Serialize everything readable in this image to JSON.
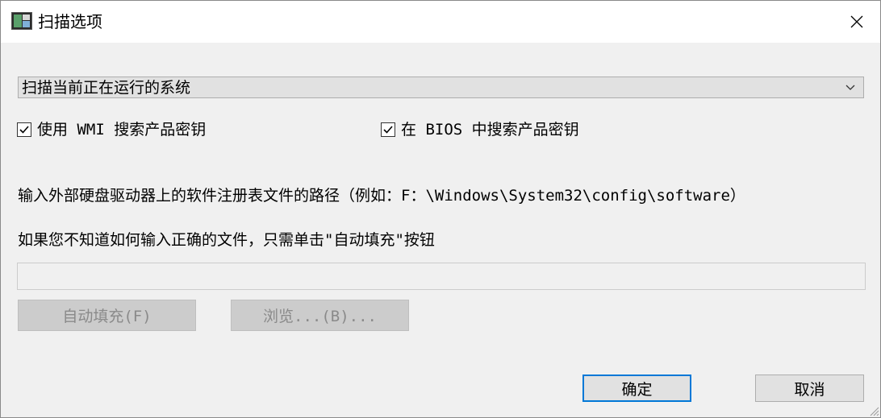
{
  "window": {
    "title": "扫描选项",
    "close_icon": "close-icon"
  },
  "scan_target": {
    "selected": "扫描当前正在运行的系统",
    "icon": "chevron-down-icon"
  },
  "options": {
    "wmi_label": "使用 WMI 搜索产品密钥",
    "wmi_checked": true,
    "bios_label": "在 BIOS 中搜索产品密钥",
    "bios_checked": true
  },
  "instructions": {
    "line1": "输入外部硬盘驱动器上的软件注册表文件的路径（例如：F：\\Windows\\System32\\config\\software）",
    "line2": "如果您不知道如何输入正确的文件，只需单击\"自动填充\"按钮"
  },
  "path_input": {
    "value": "",
    "placeholder": ""
  },
  "buttons": {
    "autofill": "自动填充(F)",
    "browse": "浏览...(B)...",
    "ok": "确定",
    "cancel": "取消"
  },
  "colors": {
    "accent": "#0078d7",
    "disabled_bg": "#cccccc",
    "window_bg": "#f0f0f0"
  }
}
